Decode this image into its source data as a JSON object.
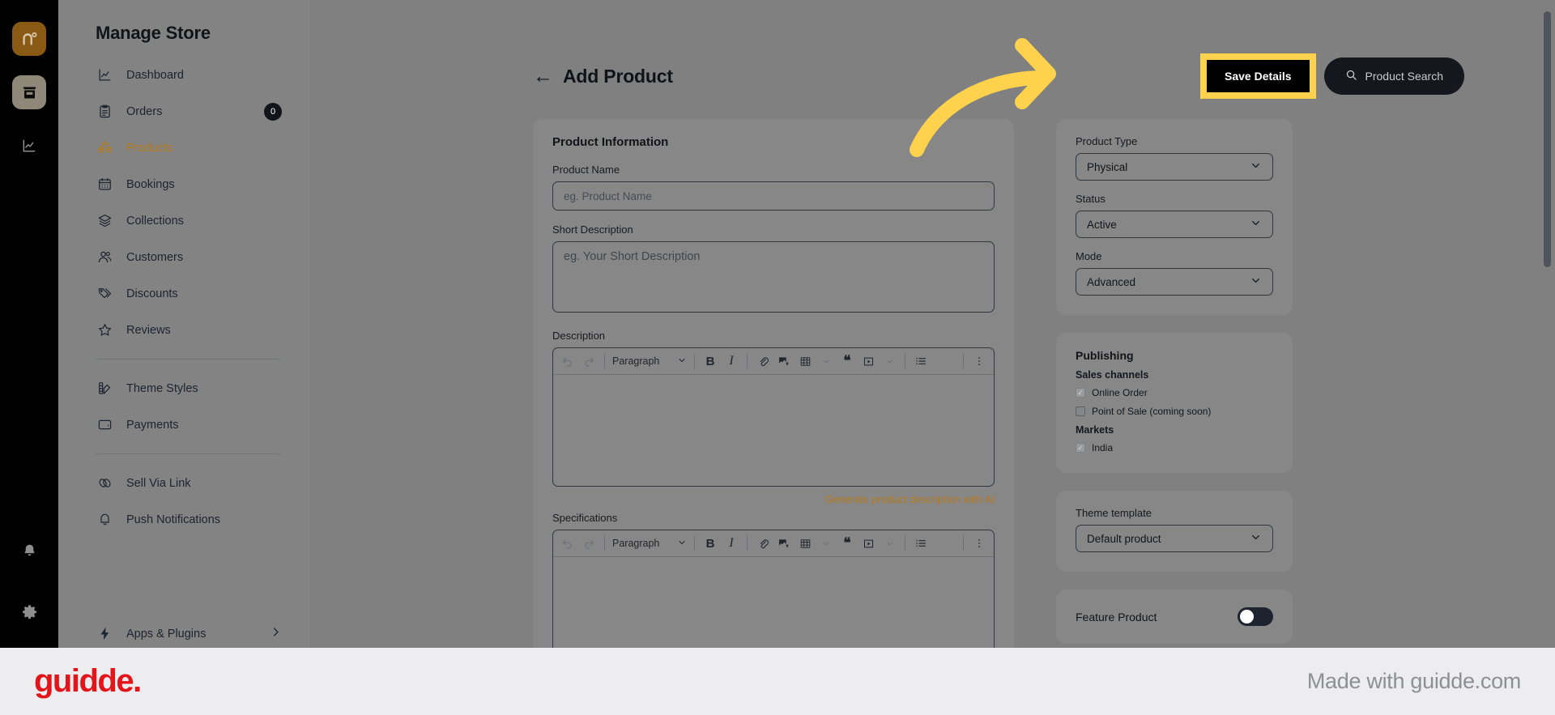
{
  "colors": {
    "brand_orange": "#b5791b",
    "logo_tile": "#8a5a15",
    "highlight_yellow": "#ffd24d",
    "guidde_red": "#e4141b",
    "dim_overlay": "#808080"
  },
  "rail": {
    "logo_icon": "brand-n-logo",
    "store_icon": "store-icon",
    "analytics_icon": "analytics-icon",
    "bell_icon": "bell-icon",
    "gear_icon": "gear-icon"
  },
  "sidebar": {
    "title": "Manage Store",
    "groups": [
      {
        "items": [
          {
            "label": "Dashboard",
            "icon": "chart-line-icon",
            "active": false
          },
          {
            "label": "Orders",
            "icon": "clipboard-icon",
            "active": false,
            "badge": "0"
          },
          {
            "label": "Products",
            "icon": "boxes-icon",
            "active": true
          },
          {
            "label": "Bookings",
            "icon": "calendar-icon",
            "active": false
          },
          {
            "label": "Collections",
            "icon": "layers-icon",
            "active": false
          },
          {
            "label": "Customers",
            "icon": "users-icon",
            "active": false
          },
          {
            "label": "Discounts",
            "icon": "tag-icon",
            "active": false
          },
          {
            "label": "Reviews",
            "icon": "star-icon",
            "active": false
          }
        ]
      },
      {
        "items": [
          {
            "label": "Theme Styles",
            "icon": "palette-icon",
            "active": false
          },
          {
            "label": "Payments",
            "icon": "wallet-icon",
            "active": false
          }
        ]
      },
      {
        "items": [
          {
            "label": "Sell Via Link",
            "icon": "link-icon",
            "active": false
          },
          {
            "label": "Push Notifications",
            "icon": "bell-outline-icon",
            "active": false
          }
        ]
      }
    ],
    "apps": {
      "label": "Apps & Plugins",
      "icon": "bolt-icon",
      "chevron": "chevron-right-icon"
    }
  },
  "header": {
    "back_icon": "arrow-left-icon",
    "title": "Add Product",
    "save_label": "Save Details",
    "search_label": "Product Search",
    "search_icon": "search-icon"
  },
  "product_information": {
    "card_title": "Product Information",
    "name_label": "Product Name",
    "name_value": "",
    "name_placeholder": "eg. Product Name",
    "short_desc_label": "Short Description",
    "short_desc_value": "",
    "short_desc_placeholder": "eg. Your Short Description",
    "description_label": "Description",
    "description_value": "",
    "ai_link": "Generate product description with AI",
    "specifications_label": "Specifications"
  },
  "editor_toolbar": {
    "undo_icon": "undo-icon",
    "redo_icon": "redo-icon",
    "block_format": "Paragraph",
    "block_chevron": "chevron-down-icon",
    "bold_label": "B",
    "italic_label": "I",
    "link_icon": "link-attach-icon",
    "image_icon": "image-upload-icon",
    "table_icon": "table-icon",
    "table_chevron": "chevron-down-icon",
    "quote_icon": "blockquote-icon",
    "video_icon": "video-icon",
    "video_chevron": "chevron-down-icon",
    "list_icon": "bullet-list-icon",
    "more_icon": "more-vertical-icon"
  },
  "settings_card": {
    "product_type_label": "Product Type",
    "product_type_value": "Physical",
    "status_label": "Status",
    "status_value": "Active",
    "mode_label": "Mode",
    "mode_value": "Advanced",
    "chevron": "chevron-down-icon"
  },
  "publishing": {
    "title": "Publishing",
    "sales_channels_label": "Sales channels",
    "channels": [
      {
        "label": "Online Order",
        "checked": true
      },
      {
        "label": "Point of Sale (coming soon)",
        "checked": false
      }
    ],
    "markets_label": "Markets",
    "markets": [
      {
        "label": "India",
        "checked": true
      }
    ]
  },
  "theme_template": {
    "label": "Theme template",
    "value": "Default product",
    "chevron": "chevron-down-icon"
  },
  "feature_product": {
    "label": "Feature Product",
    "enabled": false
  },
  "annotation": {
    "arrow_icon": "curved-arrow-right-icon",
    "target": "Save Details"
  },
  "footer": {
    "logo_text": "guidde.",
    "made_with": "Made with guidde.com"
  }
}
